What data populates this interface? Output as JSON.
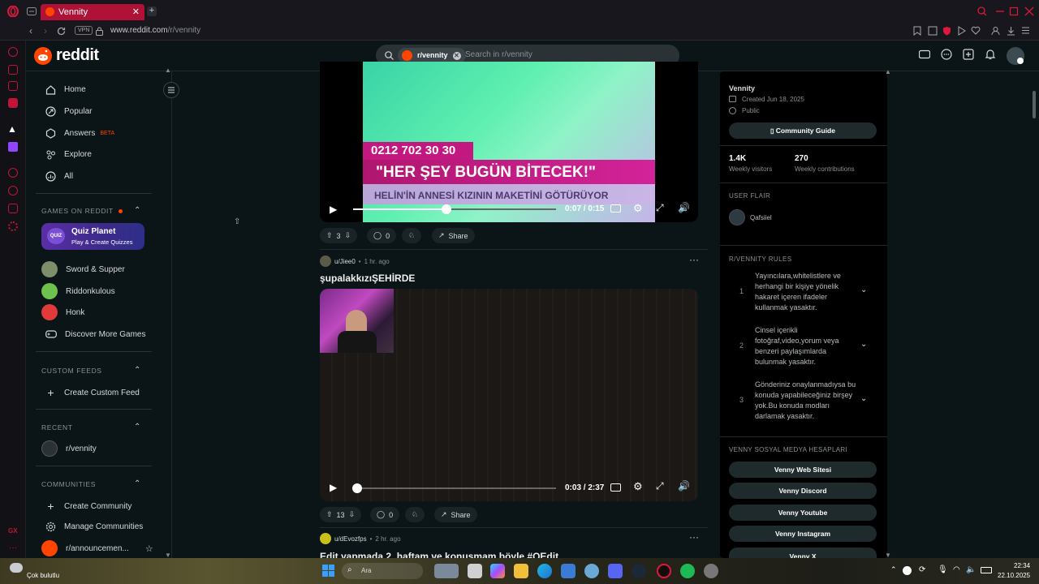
{
  "browser": {
    "tab_title": "Vennity",
    "url_host": "www.reddit.com",
    "url_path": "/r/vennity",
    "vpn_label": "VPN"
  },
  "header": {
    "logo": "reddit",
    "search_chip": "r/vennity",
    "search_placeholder": "Search in r/vennity"
  },
  "sidebar": {
    "nav": [
      {
        "label": "Home",
        "icon": "home-icon"
      },
      {
        "label": "Popular",
        "icon": "popular-icon"
      },
      {
        "label": "Answers",
        "badge": "BETA",
        "icon": "answers-icon"
      },
      {
        "label": "Explore",
        "icon": "explore-icon"
      },
      {
        "label": "All",
        "icon": "all-icon"
      }
    ],
    "games_header": "GAMES ON REDDIT",
    "quiz_title": "Quiz Planet",
    "quiz_sub": "Play & Create Quizzes",
    "games": [
      "Sword & Supper",
      "Riddonkulous",
      "Honk",
      "Discover More Games"
    ],
    "custom_feeds_header": "CUSTOM FEEDS",
    "create_custom_feed": "Create Custom Feed",
    "recent_header": "RECENT",
    "recent_item": "r/vennity",
    "communities_header": "COMMUNITIES",
    "create_community": "Create Community",
    "manage_communities": "Manage Communities",
    "announcements": "r/announcemen..."
  },
  "posts": [
    {
      "caption_phone": "0212 702 30 30",
      "caption_main": "\"HER ŞEY BUGÜN BİTECEK!\"",
      "caption_sub": "HELİN'İN ANNESİ KIZININ MAKETİNİ GÖTÜRÜYOR",
      "time": "0:07 / 0:15",
      "progress": 0.46,
      "votes": "3",
      "comments": "0",
      "share": "Share"
    },
    {
      "author": "u/Jiee0",
      "age": "1 hr. ago",
      "title": "şupalakkızıŞEHİRDE",
      "time": "0:03 / 2:37",
      "progress": 0.02,
      "votes": "13",
      "comments": "0",
      "share": "Share"
    },
    {
      "author": "u/dEvozfps",
      "age": "2 hr. ago",
      "title": "Edit yapmada 2. haftam ve konuşmam böyle #QEdit"
    }
  ],
  "community": {
    "name": "Vennity",
    "created": "Created Jun 18, 2025",
    "visibility": "Public",
    "guide_button": "Community Guide",
    "visitors": "1.4K",
    "visitors_label": "Weekly visitors",
    "contributions": "270",
    "contributions_label": "Weekly contributions",
    "user_flair_header": "USER FLAIR",
    "flair_user": "Qafsiiel",
    "rules_header": "R/VENNITY RULES",
    "rules": [
      {
        "num": "1",
        "text": "Yayıncılara,whitelistlere ve herhangi bir kişiye yönelik hakaret içeren ifadeler kullanmak yasaktır."
      },
      {
        "num": "2",
        "text": "Cinsel içerikli fotoğraf,video,yorum veya benzeri paylaşımlarda bulunmak yasaktır."
      },
      {
        "num": "3",
        "text": "Gönderiniz onaylanmadıysa bu konuda yapabileceğiniz birşey yok.Bu konuda modları darlamak yasaktır."
      }
    ],
    "social_header": "VENNY SOSYAL MEDYA HESAPLARI",
    "social_links": [
      "Venny Web Sitesi",
      "Venny Discord",
      "Venny Youtube",
      "Venny Instagram",
      "Venny X"
    ]
  },
  "taskbar": {
    "weather": "Çok bulutlu",
    "search": "Ara",
    "time": "22:34",
    "date": "22.10.2025"
  },
  "colors": {
    "reddit_orange": "#ff4500",
    "opera_red": "#b01237",
    "bg": "#0b1416"
  }
}
